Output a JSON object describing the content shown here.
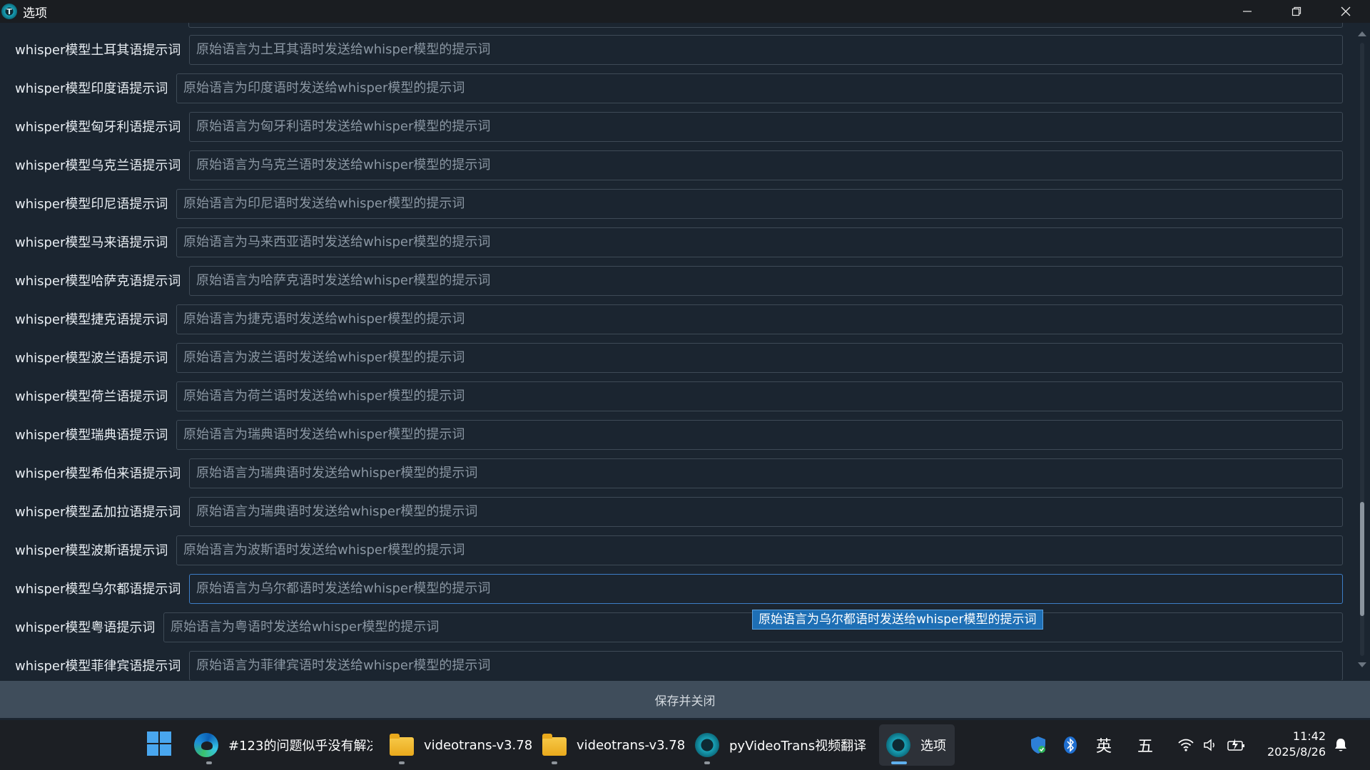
{
  "window": {
    "title": "选项",
    "app_icon_glyph": "T"
  },
  "form": {
    "rows": [
      {
        "label": "whisper模型土耳其语提示词",
        "placeholder": "原始语言为土耳其语时发送给whisper模型的提示词"
      },
      {
        "label": "whisper模型印度语提示词",
        "placeholder": "原始语言为印度语时发送给whisper模型的提示词"
      },
      {
        "label": "whisper模型匈牙利语提示词",
        "placeholder": "原始语言为匈牙利语时发送给whisper模型的提示词"
      },
      {
        "label": "whisper模型乌克兰语提示词",
        "placeholder": "原始语言为乌克兰语时发送给whisper模型的提示词"
      },
      {
        "label": "whisper模型印尼语提示词",
        "placeholder": "原始语言为印尼语时发送给whisper模型的提示词"
      },
      {
        "label": "whisper模型马来语提示词",
        "placeholder": "原始语言为马来西亚语时发送给whisper模型的提示词"
      },
      {
        "label": "whisper模型哈萨克语提示词",
        "placeholder": "原始语言为哈萨克语时发送给whisper模型的提示词"
      },
      {
        "label": "whisper模型捷克语提示词",
        "placeholder": "原始语言为捷克语时发送给whisper模型的提示词"
      },
      {
        "label": "whisper模型波兰语提示词",
        "placeholder": "原始语言为波兰语时发送给whisper模型的提示词"
      },
      {
        "label": "whisper模型荷兰语提示词",
        "placeholder": "原始语言为荷兰语时发送给whisper模型的提示词"
      },
      {
        "label": "whisper模型瑞典语提示词",
        "placeholder": "原始语言为瑞典语时发送给whisper模型的提示词"
      },
      {
        "label": "whisper模型希伯来语提示词",
        "placeholder": "原始语言为瑞典语时发送给whisper模型的提示词"
      },
      {
        "label": "whisper模型孟加拉语提示词",
        "placeholder": "原始语言为瑞典语时发送给whisper模型的提示词"
      },
      {
        "label": "whisper模型波斯语提示词",
        "placeholder": "原始语言为波斯语时发送给whisper模型的提示词"
      },
      {
        "label": "whisper模型乌尔都语提示词",
        "placeholder": "原始语言为乌尔都语时发送给whisper模型的提示词"
      },
      {
        "label": "whisper模型粤语提示词",
        "placeholder": "原始语言为粤语时发送给whisper模型的提示词"
      },
      {
        "label": "whisper模型菲律宾语提示词",
        "placeholder": "原始语言为菲律宾语时发送给whisper模型的提示词"
      }
    ]
  },
  "tooltip": {
    "text": "原始语言为乌尔都语时发送给whisper模型的提示词"
  },
  "scroll": {
    "position_fraction": 0.92
  },
  "save_button": {
    "label": "保存并关闭"
  },
  "taskbar": {
    "items": [
      {
        "label": "#123的问题似乎没有解决",
        "icon": "edge-browser-icon"
      },
      {
        "label": "videotrans-v3.78",
        "icon": "folder-icon"
      },
      {
        "label": "videotrans-v3.78",
        "icon": "folder-icon"
      },
      {
        "label": "pyVideoTrans视频翻译配音",
        "icon": "pyvideotrans-icon"
      },
      {
        "label": "选项",
        "icon": "pyvideotrans-icon",
        "active": true
      }
    ],
    "tray": {
      "ime_lang": "英",
      "ime_mode": "五",
      "time": "11:42",
      "date": "2025/8/26"
    }
  },
  "colors": {
    "background": "#1b2530",
    "input_border": "#3e4a56",
    "focus_border": "#3d7ec7",
    "tooltip_bg": "#1e6fb5",
    "button_bg": "#3f4d5b"
  }
}
